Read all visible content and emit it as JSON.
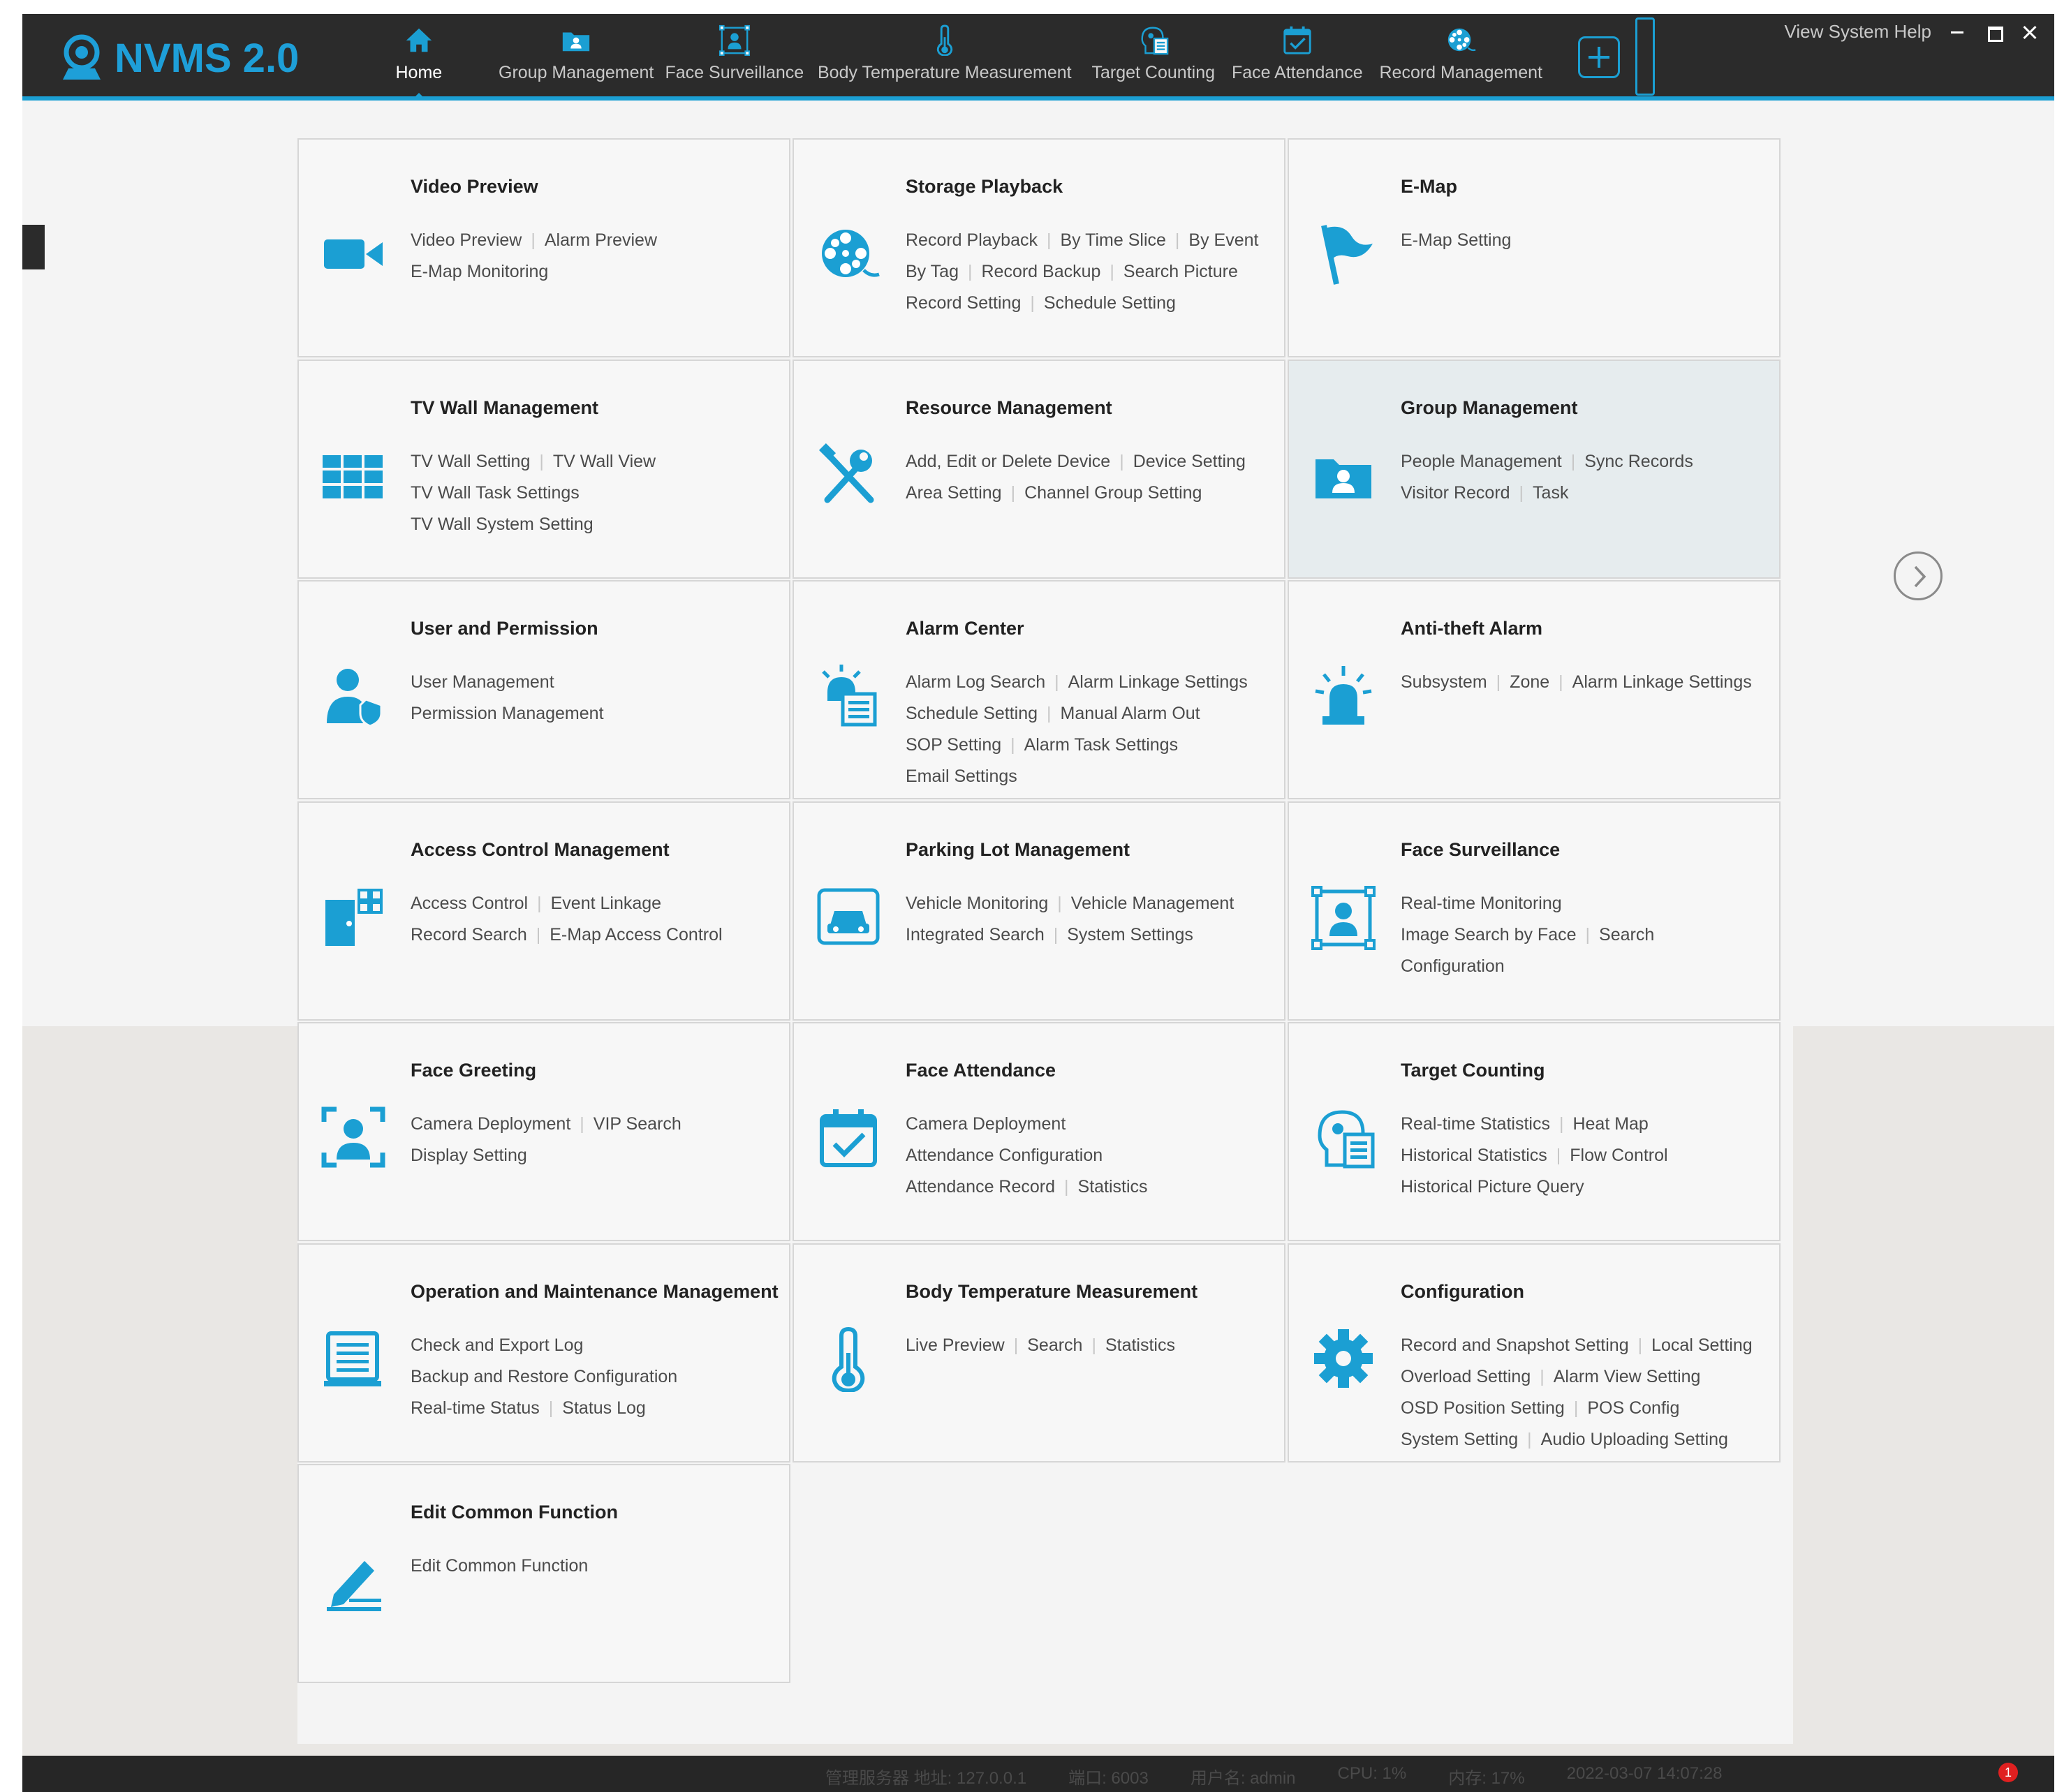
{
  "app": {
    "logo_text": "NVMS 2.0",
    "accent_color": "#1b9fd3"
  },
  "nav": {
    "items": [
      {
        "label": "Home",
        "icon": "home-icon"
      },
      {
        "label": "Group Management",
        "icon": "folder-person-icon"
      },
      {
        "label": "Face Surveillance",
        "icon": "face-frame-icon"
      },
      {
        "label": "Body Temperature Measurement",
        "icon": "thermometer-icon"
      },
      {
        "label": "Target Counting",
        "icon": "head-chart-icon"
      },
      {
        "label": "Face Attendance",
        "icon": "calendar-check-icon"
      },
      {
        "label": "Record Management",
        "icon": "film-reel-icon"
      }
    ],
    "active": "Home"
  },
  "window": {
    "menu_text": "View System Help"
  },
  "tiles": [
    {
      "title": "Video Preview",
      "icon": "video-camera-icon",
      "links": [
        [
          "Video Preview",
          "Alarm Preview"
        ],
        [
          "E-Map Monitoring"
        ]
      ]
    },
    {
      "title": "Storage Playback",
      "icon": "film-reel-icon",
      "links": [
        [
          "Record Playback",
          "By Time Slice",
          "By Event"
        ],
        [
          "By Tag",
          "Record Backup",
          "Search Picture"
        ],
        [
          "Record Setting",
          "Schedule Setting"
        ]
      ]
    },
    {
      "title": "E-Map",
      "icon": "flag-icon",
      "links": [
        [
          "E-Map Setting"
        ]
      ]
    },
    {
      "title": "TV Wall Management",
      "icon": "tv-wall-grid-icon",
      "links": [
        [
          "TV Wall Setting",
          "TV Wall View"
        ],
        [
          "TV Wall Task Settings"
        ],
        [
          "TV Wall System Setting"
        ]
      ]
    },
    {
      "title": "Resource Management",
      "icon": "tools-icon",
      "links": [
        [
          "Add, Edit or Delete Device",
          "Device Setting"
        ],
        [
          "Area Setting",
          "Channel Group Setting"
        ]
      ]
    },
    {
      "title": "Group Management",
      "icon": "folder-person-icon",
      "links": [
        [
          "People Management",
          "Sync Records"
        ],
        [
          "Visitor Record",
          "Task"
        ]
      ]
    },
    {
      "title": "User and Permission",
      "icon": "user-shield-icon",
      "links": [
        [
          "User Management"
        ],
        [
          "Permission Management"
        ]
      ]
    },
    {
      "title": "Alarm Center",
      "icon": "alarm-list-icon",
      "links": [
        [
          "Alarm Log Search",
          "Alarm Linkage Settings"
        ],
        [
          "Schedule Setting",
          "Manual Alarm Out"
        ],
        [
          "SOP Setting",
          "Alarm Task Settings"
        ],
        [
          "Email Settings"
        ]
      ]
    },
    {
      "title": "Anti-theft Alarm",
      "icon": "siren-icon",
      "links": [
        [
          "Subsystem",
          "Zone",
          "Alarm Linkage Settings"
        ]
      ]
    },
    {
      "title": "Access Control Management",
      "icon": "door-access-icon",
      "links": [
        [
          "Access Control",
          "Event Linkage"
        ],
        [
          "Record Search",
          "E-Map Access Control"
        ]
      ]
    },
    {
      "title": "Parking Lot Management",
      "icon": "car-monitor-icon",
      "links": [
        [
          "Vehicle Monitoring",
          "Vehicle Management"
        ],
        [
          "Integrated Search",
          "System Settings"
        ]
      ]
    },
    {
      "title": "Face Surveillance",
      "icon": "face-frame-icon",
      "links": [
        [
          "Real-time Monitoring"
        ],
        [
          "Image Search by Face",
          "Search"
        ],
        [
          "Configuration"
        ]
      ]
    },
    {
      "title": "Face Greeting",
      "icon": "face-scan-icon",
      "links": [
        [
          "Camera Deployment",
          "VIP Search"
        ],
        [
          "Display Setting"
        ]
      ]
    },
    {
      "title": "Face Attendance",
      "icon": "calendar-check-icon",
      "links": [
        [
          "Camera Deployment"
        ],
        [
          "Attendance Configuration"
        ],
        [
          "Attendance Record",
          "Statistics"
        ]
      ]
    },
    {
      "title": "Target Counting",
      "icon": "head-chart-icon",
      "links": [
        [
          "Real-time Statistics",
          "Heat Map"
        ],
        [
          "Historical Statistics",
          "Flow Control"
        ],
        [
          "Historical Picture Query"
        ]
      ]
    },
    {
      "title": "Operation and Maintenance Management",
      "icon": "monitor-log-icon",
      "links": [
        [
          "Check and Export Log"
        ],
        [
          "Backup and Restore Configuration"
        ],
        [
          "Real-time Status",
          "Status Log"
        ]
      ]
    },
    {
      "title": "Body Temperature Measurement",
      "icon": "thermometer-icon",
      "links": [
        [
          "Live Preview",
          "Search",
          "Statistics"
        ]
      ]
    },
    {
      "title": "Configuration",
      "icon": "gear-icon",
      "links": [
        [
          "Record and Snapshot Setting",
          "Local Setting"
        ],
        [
          "Overload Setting",
          "Alarm View Setting"
        ],
        [
          "OSD Position Setting",
          "POS Config"
        ],
        [
          "System Setting",
          "Audio Uploading Setting"
        ]
      ]
    },
    {
      "title": "Edit Common Function",
      "icon": "edit-pen-icon",
      "links": [
        [
          "Edit Common Function"
        ]
      ]
    }
  ],
  "highlighted_tile": "Group Management",
  "statusbar": {
    "items": [
      "管理服务器 地址: 127.0.0.1",
      "端口: 6003",
      "用户名: admin",
      "CPU: 1%",
      "内存: 17%",
      "2022-03-07 14:07:28"
    ],
    "badge": "1"
  }
}
